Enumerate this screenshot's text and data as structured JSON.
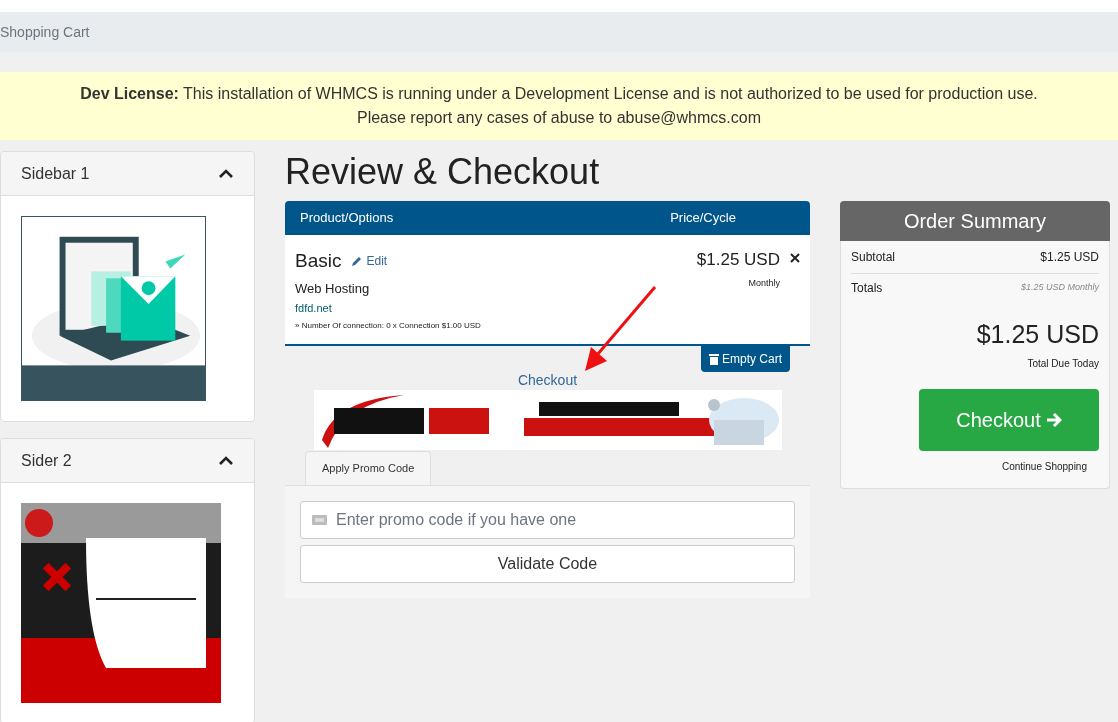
{
  "breadcrumb": "Shopping Cart",
  "notice": {
    "label": "Dev License:",
    "line1": "This installation of WHMCS is running under a Development License and is not authorized to be used for production use.",
    "line2": "Please report any cases of abuse to abuse@whmcs.com"
  },
  "sidebar": [
    {
      "title": "Sidebar 1",
      "expanded": true
    },
    {
      "title": "Sider 2",
      "expanded": true
    }
  ],
  "page_title": "Review & Checkout",
  "cart": {
    "columns": [
      "Product/Options",
      "Price/Cycle"
    ],
    "items": [
      {
        "name": "Basic",
        "edit": "Edit",
        "group": "Web Hosting",
        "domain": "fdfd.net",
        "option": "» Number Of connection: 0 x Connection $1.00 USD",
        "price": "$1.25 USD",
        "cycle": "Monthly"
      }
    ],
    "empty_button": "Empty Cart"
  },
  "checkout_link": "Checkout",
  "promo": {
    "tabs": [
      {
        "label": "Apply Promo Code",
        "selected": true
      }
    ],
    "placeholder": "Enter promo code if you have one",
    "button": "Validate Code"
  },
  "summary": {
    "title": "Order Summary",
    "rows": [
      {
        "label": "Subtotal",
        "value": "$1.25 USD",
        "kind": "plain"
      },
      {
        "label": "Totals",
        "value": "$1.25 USD Monthly",
        "kind": "muted"
      }
    ],
    "total": "$1.25 USD",
    "total_label": "Total Due Today",
    "checkout": "Checkout",
    "continue": "Continue Shopping"
  }
}
